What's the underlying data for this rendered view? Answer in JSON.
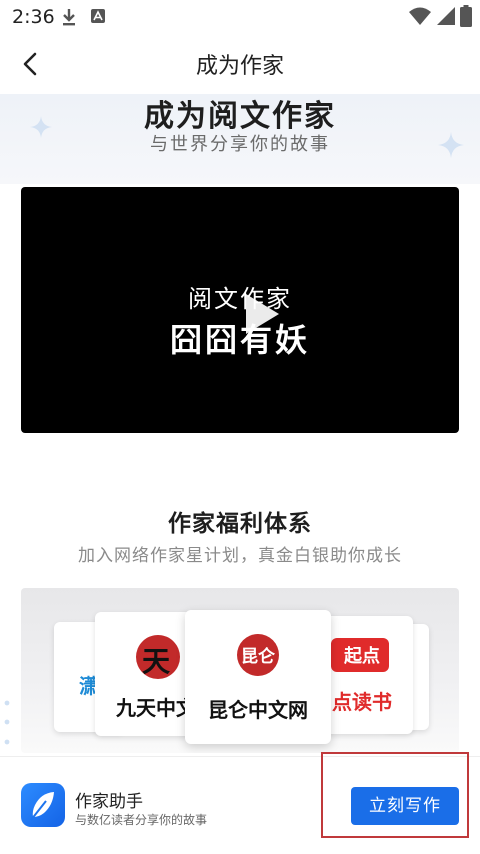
{
  "status_bar": {
    "time": "2:36"
  },
  "app_bar": {
    "title": "成为作家"
  },
  "hero": {
    "title": "成为阅文作家",
    "subtitle": "与世界分享你的故事"
  },
  "video": {
    "line1": "阅文作家",
    "line2": "囧囧有妖"
  },
  "benefits": {
    "title": "作家福利体系",
    "subtitle": "加入网络作家星计划，真金白银助你成长",
    "cards": [
      {
        "logo_glyph": "潇"
      },
      {
        "logo_glyph": "天",
        "label": "九天中文"
      },
      {
        "logo_glyph": "昆仑",
        "label": "昆仑中文网"
      },
      {
        "logo_glyph": "起点",
        "label": "点读书"
      }
    ]
  },
  "bottom_bar": {
    "app_name": "作家助手",
    "app_desc": "与数亿读者分享你的故事",
    "cta_label": "立刻写作"
  },
  "colors": {
    "accent": "#1a6ee8",
    "highlight": "#c0393b"
  }
}
